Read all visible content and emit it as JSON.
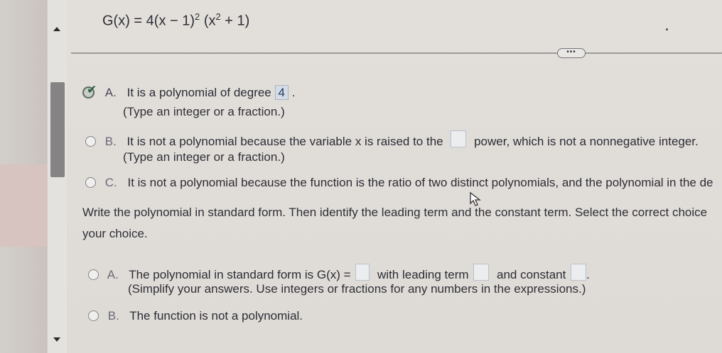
{
  "formula": {
    "lhs": "G(x) = 4(x − 1)",
    "exp1": "2",
    "paren_open": "(x",
    "exp2": "2",
    "rest": " + 1)"
  },
  "more_button": "•••",
  "part1": {
    "options": [
      {
        "letter": "A.",
        "text_before": "It is a polynomial of degree",
        "answer": "4",
        "text_after": ".",
        "hint": "(Type an integer or a fraction.)",
        "selected": true
      },
      {
        "letter": "B.",
        "text_before": "It is not a polynomial because the variable x is raised to the",
        "text_after": "power, which is not a nonnegative integer.",
        "hint": "(Type an integer or a fraction.)",
        "selected": false
      },
      {
        "letter": "C.",
        "text": "It is not a polynomial because the function is the ratio of two distinct polynomials, and the polynomial in the de",
        "selected": false
      }
    ]
  },
  "part2": {
    "prompt_line1": "Write the polynomial in standard form. Then identify the leading term and the constant term. Select the correct choice",
    "prompt_line2": "your choice.",
    "options": [
      {
        "letter": "A.",
        "text1": "The polynomial in standard form is G(x) =",
        "text2": "with leading term",
        "text3": "and constant",
        "text4": ".",
        "hint": "(Simplify your answers. Use integers or fractions for any numbers in the expressions.)"
      },
      {
        "letter": "B.",
        "text": "The function is not a polynomial."
      }
    ]
  }
}
